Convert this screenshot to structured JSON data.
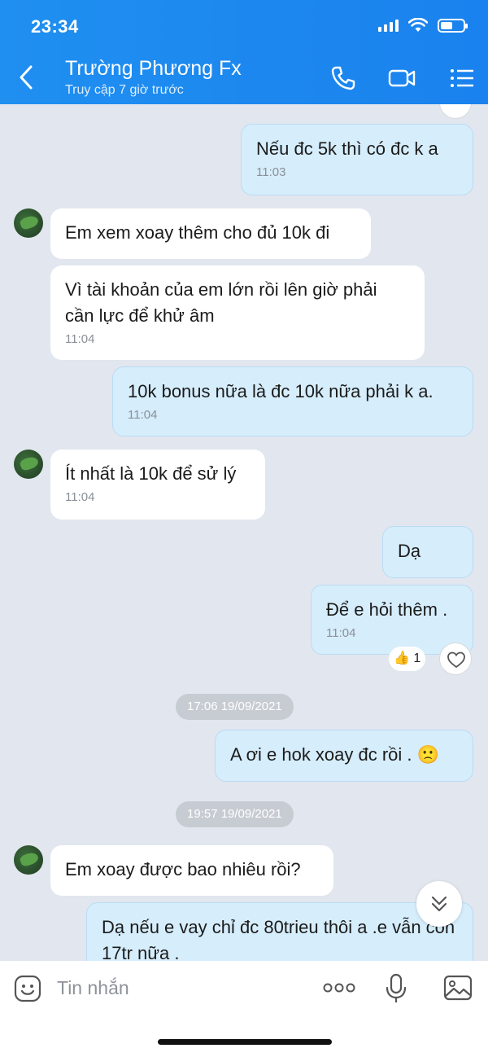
{
  "status_bar": {
    "time": "23:34"
  },
  "header": {
    "contact_name": "Trường Phương Fx",
    "last_seen": "Truy cập 7 giờ trước",
    "icons": [
      "back-icon",
      "phone-icon",
      "video-call-icon",
      "menu-list-icon"
    ]
  },
  "messages": [
    {
      "dir": "out",
      "text": "Nếu đc 5k thì có đc k a",
      "time": "11:03"
    },
    {
      "dir": "in",
      "text": "Em xem xoay thêm cho đủ 10k đi",
      "time": ""
    },
    {
      "dir": "in",
      "text": "Vì tài khoản của em lớn rồi lên giờ phải cần lực để khử âm",
      "time": "11:04"
    },
    {
      "dir": "out",
      "text": "10k bonus nữa là đc 10k nữa phải k a.",
      "time": "11:04"
    },
    {
      "dir": "in",
      "text": "Ít nhất là 10k để sử lý",
      "time": "11:04"
    },
    {
      "dir": "out",
      "text": "Dạ",
      "time": ""
    },
    {
      "dir": "out",
      "text": "Để e hỏi thêm .",
      "time": "11:04",
      "reaction": {
        "emoji": "👍",
        "count": "1"
      }
    },
    {
      "dir": "out",
      "text": "A ơi e hok xoay đc rồi .",
      "emoji": "🙁",
      "time": ""
    },
    {
      "dir": "in",
      "text": "Em xoay được bao nhiêu rồi?",
      "time": ""
    },
    {
      "dir": "out",
      "text": "Dạ nếu e vay chỉ đc 80trieu thôi a .e vẫn còn 17tr nữa .",
      "time": ""
    }
  ],
  "date_dividers": [
    "17:06 19/09/2021",
    "19:57 19/09/2021"
  ],
  "input_bar": {
    "placeholder": "Tin nhắn"
  },
  "colors": {
    "header": "#1a86ef",
    "outgoing_bubble": "#d6edfb",
    "incoming_bubble": "#ffffff",
    "background": "#e2e6ee"
  }
}
